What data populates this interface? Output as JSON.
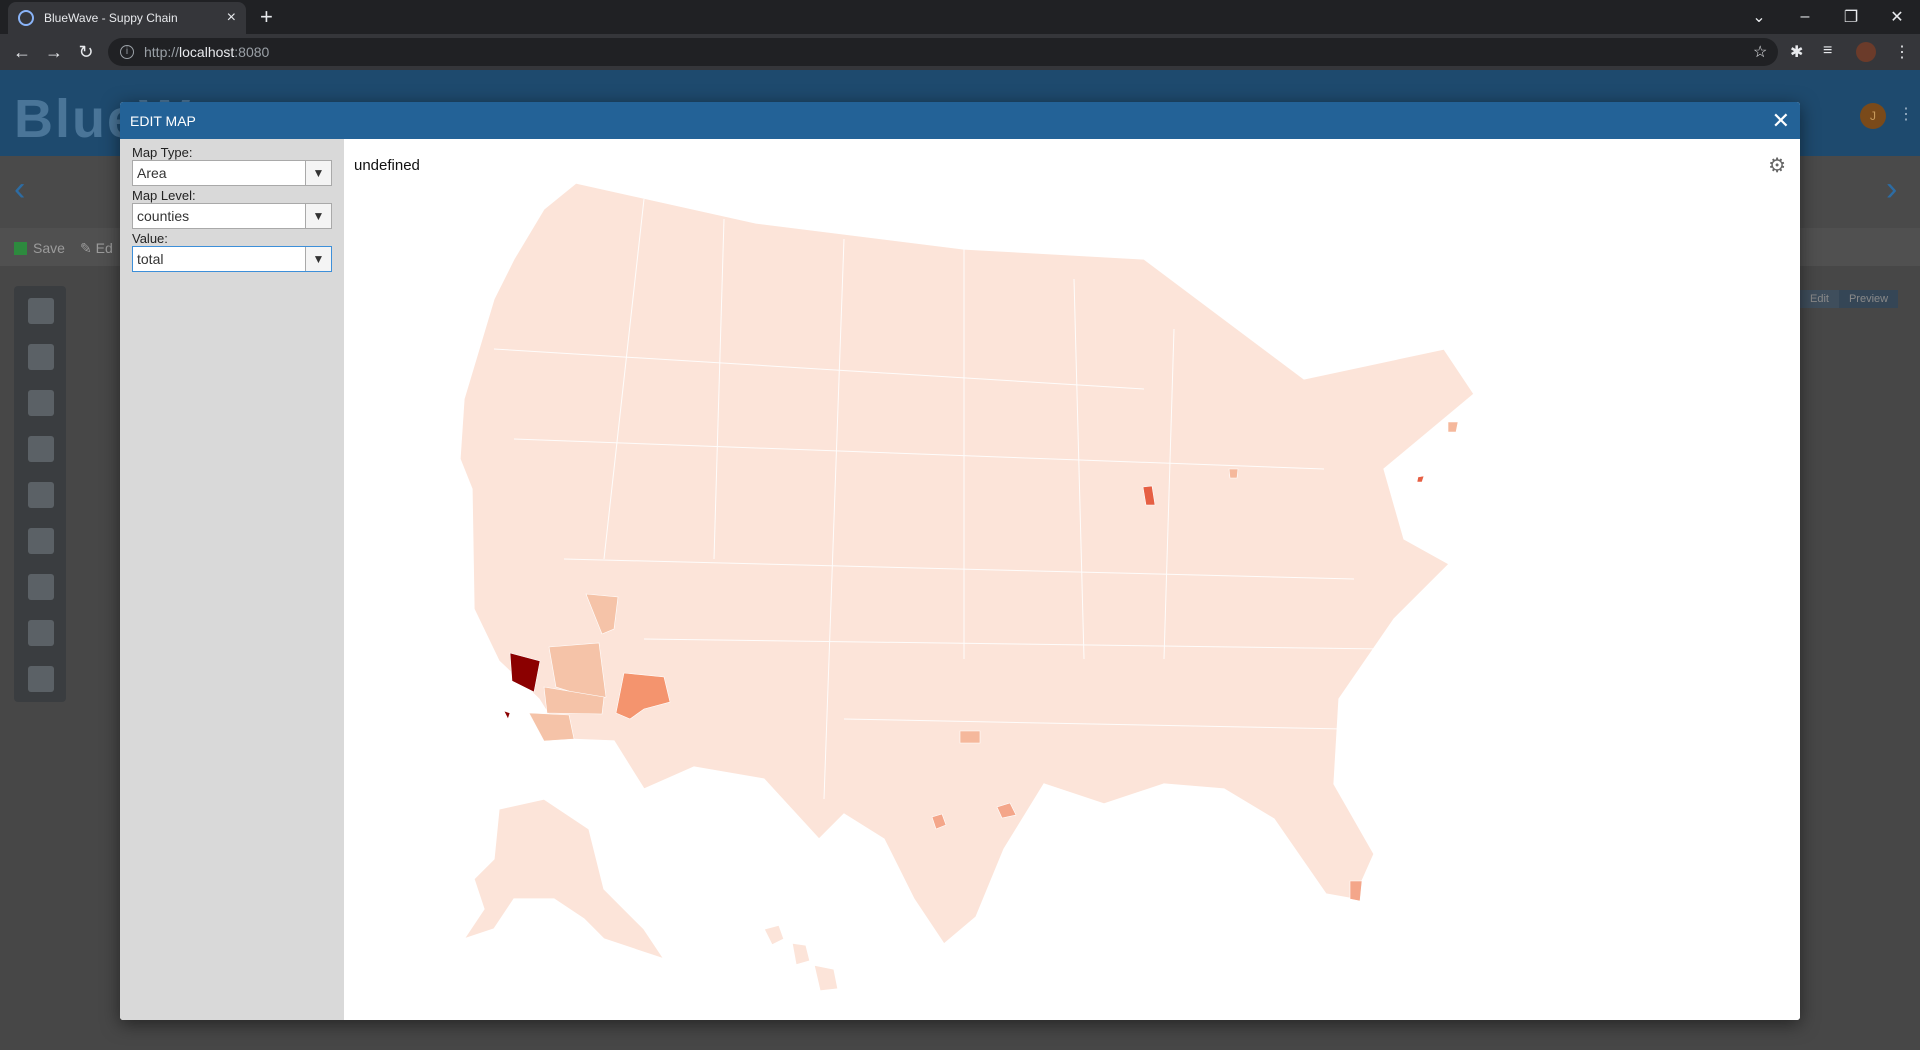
{
  "browser": {
    "tab_title": "BlueWave - Suppy Chain",
    "url_scheme": "http://",
    "url_host": "localhost",
    "url_port": ":8080"
  },
  "app": {
    "logo_text": "BlueW",
    "avatar_initial": "J",
    "save_label": "Save",
    "edit_label": "Ed",
    "toggle_edit": "Edit",
    "toggle_preview": "Preview"
  },
  "dialog": {
    "title": "EDIT MAP",
    "close_label": "✕",
    "fields": {
      "map_type_label": "Map Type:",
      "map_type_value": "Area",
      "map_level_label": "Map Level:",
      "map_level_value": "counties",
      "value_label": "Value:",
      "value_value": "total"
    },
    "map_title": "undefined"
  },
  "map": {
    "type": "choropleth",
    "region": "United States counties",
    "base_color": "#fce4d9",
    "highlighted_regions": [
      {
        "name": "Los Angeles County, CA",
        "color": "#8b0000"
      },
      {
        "name": "San Bernardino County, CA",
        "color": "#f5c3a8"
      },
      {
        "name": "Riverside County, CA",
        "color": "#f5c3a8"
      },
      {
        "name": "San Diego County, CA",
        "color": "#f5c3a8"
      },
      {
        "name": "Clark County, NV",
        "color": "#f5c3a8"
      },
      {
        "name": "Maricopa County, AZ",
        "color": "#f4946e"
      },
      {
        "name": "Cook County, IL",
        "color": "#e65f43"
      },
      {
        "name": "Wayne County, MI",
        "color": "#f5b89c"
      },
      {
        "name": "Middlesex County, MA",
        "color": "#f5b89c"
      },
      {
        "name": "New York City, NY",
        "color": "#e65f43"
      },
      {
        "name": "Dallas County, TX",
        "color": "#f5b89c"
      },
      {
        "name": "Harris County, TX",
        "color": "#f4a68a"
      },
      {
        "name": "Bexar County, TX",
        "color": "#f4a68a"
      },
      {
        "name": "Miami-Dade County, FL",
        "color": "#f4a68a"
      }
    ]
  }
}
